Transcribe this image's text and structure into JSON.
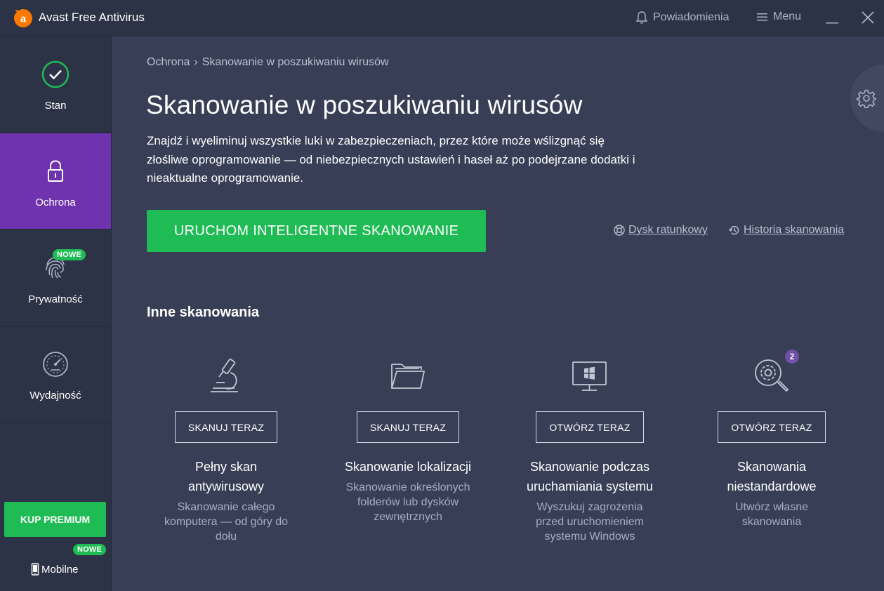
{
  "titlebar": {
    "app_title": "Avast Free Antivirus",
    "notifications_label": "Powiadomienia",
    "menu_label": "Menu"
  },
  "sidebar": {
    "items": [
      {
        "label": "Stan",
        "icon": "check-circle-icon"
      },
      {
        "label": "Ochrona",
        "icon": "lock-icon"
      },
      {
        "label": "Prywatność",
        "icon": "fingerprint-icon",
        "badge": "NOWE"
      },
      {
        "label": "Wydajność",
        "icon": "speedometer-icon"
      }
    ],
    "buy_label": "KUP PREMIUM",
    "mobile_badge": "NOWE",
    "mobile_label": "Mobilne"
  },
  "breadcrumb": {
    "parent": "Ochrona",
    "separator": "›",
    "current": "Skanowanie w poszukiwaniu wirusów"
  },
  "main": {
    "title": "Skanowanie w poszukiwaniu wirusów",
    "description": "Znajdź i wyeliminuj wszystkie luki w zabezpieczeniach, przez które może wślizgnąć się złośliwe oprogramowanie — od niebezpiecznych ustawień i haseł aż po podejrzane dodatki i nieaktualne oprogramowanie.",
    "smart_scan_label": "URUCHOM INTELIGENTNE SKANOWANIE",
    "rescue_disk_label": "Dysk ratunkowy",
    "history_label": "Historia skanowania",
    "other_scans_title": "Inne skanowania"
  },
  "scans": [
    {
      "icon": "microscope-icon",
      "button": "SKANUJ TERAZ",
      "title": "Pełny skan antywirusowy",
      "desc": "Skanowanie całego komputera — od góry do dołu"
    },
    {
      "icon": "folder-icon",
      "button": "SKANUJ TERAZ",
      "title": "Skanowanie lokalizacji",
      "desc": "Skanowanie określonych folderów lub dysków zewnętrznych"
    },
    {
      "icon": "windows-monitor-icon",
      "button": "OTWÓRZ TERAZ",
      "title": "Skanowanie podczas uruchamiania systemu",
      "desc": "Wyszukuj zagrożenia przed uruchomieniem systemu Windows"
    },
    {
      "icon": "gear-search-icon",
      "button": "OTWÓRZ TERAZ",
      "title": "Skanowania niestandardowe",
      "desc": "Utwórz własne skanowania",
      "count": "2"
    }
  ],
  "colors": {
    "background": "#373e56",
    "sidebar": "#2d3347",
    "accent_purple": "#6f33b0",
    "accent_green": "#1fbc55",
    "logo_orange": "#ff7800"
  }
}
